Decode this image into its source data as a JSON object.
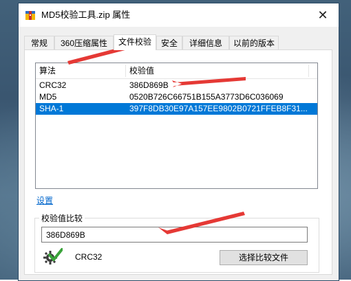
{
  "window": {
    "title": "MD5校验工具.zip 属性",
    "close_label": "✕"
  },
  "tabs": [
    {
      "label": "常规",
      "active": false
    },
    {
      "label": "360压缩属性",
      "active": false
    },
    {
      "label": "文件校验",
      "active": true
    },
    {
      "label": "安全",
      "active": false
    },
    {
      "label": "详细信息",
      "active": false
    },
    {
      "label": "以前的版本",
      "active": false
    }
  ],
  "hash_list": {
    "columns": [
      "算法",
      "校验值"
    ],
    "rows": [
      {
        "algorithm": "CRC32",
        "value": "386D869B",
        "selected": false
      },
      {
        "algorithm": "MD5",
        "value": "0520B726C66751B155A3773D6C036069",
        "selected": false
      },
      {
        "algorithm": "SHA-1",
        "value": "397F8DB30E97A157EE9802B0721FFEB8F31...",
        "selected": true
      }
    ]
  },
  "settings_link": "设置",
  "compare": {
    "group_title": "校验值比较",
    "input_value": "386D869B",
    "match_algorithm": "CRC32",
    "select_file_button": "选择比较文件"
  },
  "colors": {
    "selection": "#0078d7",
    "annotation_arrow": "#e53935",
    "link": "#0066cc",
    "check_green": "#3aa33a"
  }
}
